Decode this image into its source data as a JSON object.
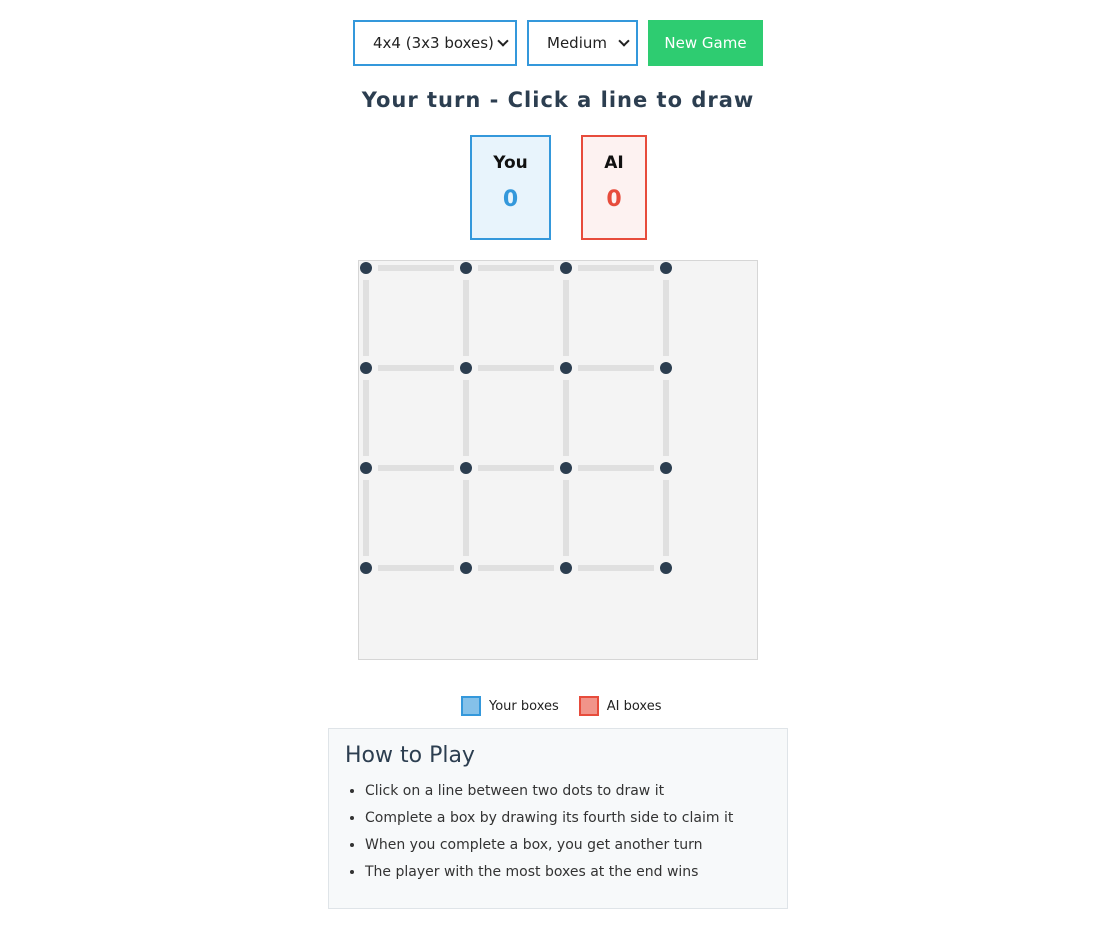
{
  "controls": {
    "board_size": {
      "selected": "4x4 (3x3 boxes)"
    },
    "difficulty": {
      "selected": "Medium"
    },
    "new_game_label": "New Game"
  },
  "status_text": "Your turn - Click a line to draw",
  "scores": {
    "you": {
      "label": "You",
      "value": "0"
    },
    "ai": {
      "label": "AI",
      "value": "0"
    }
  },
  "board": {
    "dots_per_side": 4,
    "claimed_boxes": [],
    "drawn_lines": []
  },
  "legend": {
    "you": "Your boxes",
    "ai": "AI boxes"
  },
  "how_to_play": {
    "title": "How to Play",
    "rules": [
      "Click on a line between two dots to draw it",
      "Complete a box by drawing its fourth side to claim it",
      "When you complete a box, you get another turn",
      "The player with the most boxes at the end wins"
    ]
  },
  "colors": {
    "player": "#3498db",
    "ai": "#e74c3c",
    "accent_button": "#2ecc71",
    "dot": "#2c3e50",
    "undrawn_line": "#e0e0e0",
    "board_bg": "#f4f4f4"
  }
}
